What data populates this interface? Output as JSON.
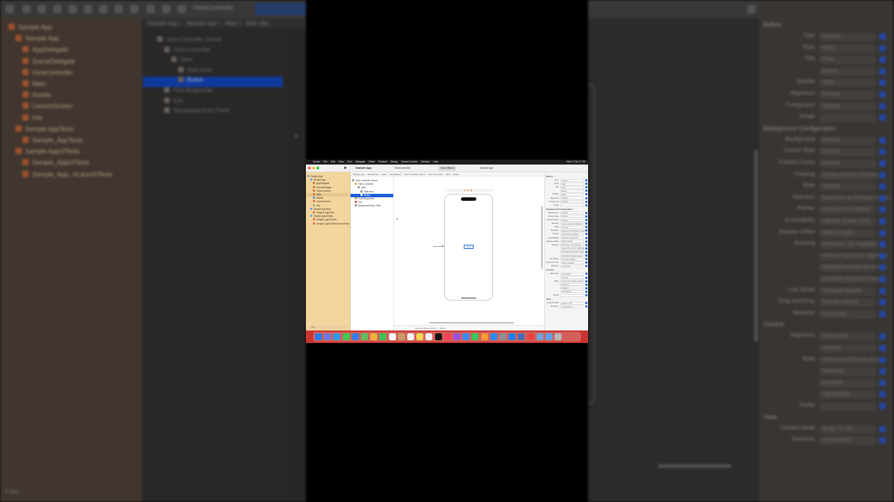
{
  "app": {
    "menu": [
      "Xcode",
      "File",
      "Edit",
      "View",
      "Find",
      "Navigate",
      "Editor",
      "Product",
      "Debug",
      "Source Control",
      "Window",
      "Help"
    ],
    "menu_right": "Wed 7 Feb 17:33",
    "window_title": "Sample App",
    "tabs": [
      "ViewController",
      "Main (Base)",
      "Sample App"
    ],
    "status": "Finished running Sample App on iPhone 15 Pro",
    "jump_bar": "Sample App  〉 Sample App 〉 Main  〉 Main (Base) 〉 View Controller Scene 〉 View Controller 〉 View 〉 Button",
    "filter_placeholder": "Filter"
  },
  "navigator": {
    "items": [
      {
        "label": "Sample App",
        "indent": 0,
        "icon": "project-icon"
      },
      {
        "label": "Sample App",
        "indent": 1,
        "icon": "folder-icon"
      },
      {
        "label": "AppDelegate",
        "indent": 2,
        "icon": "swift-file-icon"
      },
      {
        "label": "SceneDelegate",
        "indent": 2,
        "icon": "swift-file-icon"
      },
      {
        "label": "ViewController",
        "indent": 2,
        "icon": "swift-file-icon"
      },
      {
        "label": "Main",
        "indent": 2,
        "icon": "storyboard-icon",
        "selected": true
      },
      {
        "label": "Assets",
        "indent": 2,
        "icon": "assets-icon"
      },
      {
        "label": "LaunchScreen",
        "indent": 2,
        "icon": "storyboard-icon"
      },
      {
        "label": "Info",
        "indent": 2,
        "icon": "plist-icon"
      },
      {
        "label": "Sample AppTests",
        "indent": 1,
        "icon": "folder-icon"
      },
      {
        "label": "Sample_AppTests",
        "indent": 2,
        "icon": "swift-file-icon"
      },
      {
        "label": "Sample AppUITests",
        "indent": 1,
        "icon": "folder-icon"
      },
      {
        "label": "Sample_AppUITests",
        "indent": 2,
        "icon": "swift-file-icon"
      },
      {
        "label": "Sample_AppUITestsLaunchTests",
        "indent": 2,
        "icon": "swift-file-icon"
      }
    ]
  },
  "outline": {
    "items": [
      {
        "label": "View Controller Scene",
        "indent": 0
      },
      {
        "label": "View Controller",
        "indent": 1
      },
      {
        "label": "View",
        "indent": 2
      },
      {
        "label": "Safe Area",
        "indent": 3
      },
      {
        "label": "Button",
        "indent": 3,
        "selected": true
      },
      {
        "label": "First Responder",
        "indent": 1
      },
      {
        "label": "Exit",
        "indent": 1
      },
      {
        "label": "Storyboard Entry Point",
        "indent": 1
      }
    ]
  },
  "canvas": {
    "button_label": "Button",
    "bottom_bar": "View as: iPhone 15 Pro    ―   76%   +"
  },
  "inspector": {
    "section": "Button",
    "rows": [
      {
        "label": "Type",
        "value": "System"
      },
      {
        "label": "Style",
        "value": "Plain"
      },
      {
        "label": "Title",
        "value": "Plain"
      },
      {
        "label": "",
        "value": "Button"
      },
      {
        "label": "Subtitle",
        "value": "Plain"
      },
      {
        "label": "Alignment",
        "value": "Default"
      },
      {
        "label": "Foreground",
        "value": "Default"
      },
      {
        "label": "Image",
        "value": ""
      }
    ],
    "bg_section": "Background Configuration",
    "bg_rows": [
      {
        "label": "Background",
        "value": "Default"
      },
      {
        "label": "Corner Style",
        "value": "Default"
      },
      {
        "label": "Content Insets",
        "value": "Default"
      },
      {
        "label": "Drawing",
        "value": "Shows Activity Indicator"
      },
      {
        "label": "Style",
        "value": "Normal"
      },
      {
        "label": "Selection",
        "value": "Selection as Primary Action"
      },
      {
        "label": "Pointer",
        "value": "Interaction Enabled"
      },
      {
        "label": "Accessibility",
        "value": "Adjusts Image Size"
      },
      {
        "label": "Shadow Offset",
        "value": "Width   Height"
      },
      {
        "label": "Drawing",
        "value": "Reverses On Highlight"
      },
      {
        "label": "",
        "value": "Shows Touch On Highlight"
      },
      {
        "label": "",
        "value": "Highlighted Adjusts Image"
      },
      {
        "label": "",
        "value": "Disabled Adjusts Image"
      },
      {
        "label": "Line Break",
        "value": "Truncate Middle"
      },
      {
        "label": "Drag and Drop",
        "value": "Spring Loaded"
      },
      {
        "label": "Behavior",
        "value": "Automatic"
      }
    ],
    "control_section": "Control",
    "control_rows": [
      {
        "label": "Alignment",
        "value": "Horizontal"
      },
      {
        "label": "",
        "value": "Vertical"
      },
      {
        "label": "State",
        "value": "Shows as Primary action"
      },
      {
        "label": "",
        "value": "Selected"
      },
      {
        "label": "",
        "value": "Enabled"
      },
      {
        "label": "",
        "value": "Highlighted"
      },
      {
        "label": "Tooltip",
        "value": ""
      }
    ],
    "view_section": "View",
    "view_rows": [
      {
        "label": "Content Mode",
        "value": "Scale To Fill"
      },
      {
        "label": "Semantic",
        "value": "Unspecified"
      }
    ]
  },
  "dock": {
    "apps": [
      "Finder",
      "Launchpad",
      "Safari",
      "Messages",
      "Mail",
      "Maps",
      "Photos",
      "FaceTime",
      "Calendar",
      "Contacts",
      "Reminders",
      "Notes",
      "Freeform",
      "TV",
      "Music",
      "Podcasts",
      "Keynote",
      "Numbers",
      "Pages",
      "App Store",
      "System Settings",
      "Xcode",
      "Simulator",
      "Chrome",
      "Preview",
      "Downloads",
      "Trash"
    ],
    "colors": [
      "#2a7ef0",
      "#6d7ae8",
      "#2d9af2",
      "#3fcb52",
      "#2f82ea",
      "#5fbf5c",
      "#f0b43a",
      "#3cc153",
      "#ffffff",
      "#c99c6a",
      "#f4f4f4",
      "#f7d552",
      "#f2f2f2",
      "#111111",
      "#f4405b",
      "#9a4fe0",
      "#3a8af2",
      "#34c759",
      "#f59a2d",
      "#2a8cf5",
      "#8e8e93",
      "#1e7ff0",
      "#4b6cb5",
      "#e8453c",
      "#6fa5d8",
      "#5da1f0",
      "#b8b8b8"
    ]
  },
  "background": {
    "nav_items": [
      "Sample App",
      "Sample App",
      "AppDelegate",
      "SceneDelegate",
      "ViewController",
      "Main",
      "Assets",
      "LaunchScreen",
      "Info",
      "Sample AppTests",
      "Sample_AppTests",
      "Sample AppUITests",
      "Sample_AppUITests",
      "Sample_App...hLaunchTests"
    ],
    "outline_items": [
      "View Controller Scene",
      "View Controller",
      "View",
      "Safe Area",
      "Button",
      "First Responder",
      "Exit",
      "Storyboard Entry Point"
    ],
    "jump": "Sample App 〉 Sample App 〉 Main 〉 Main (Ba...",
    "tab": "ViewController",
    "filter": "Filter"
  }
}
